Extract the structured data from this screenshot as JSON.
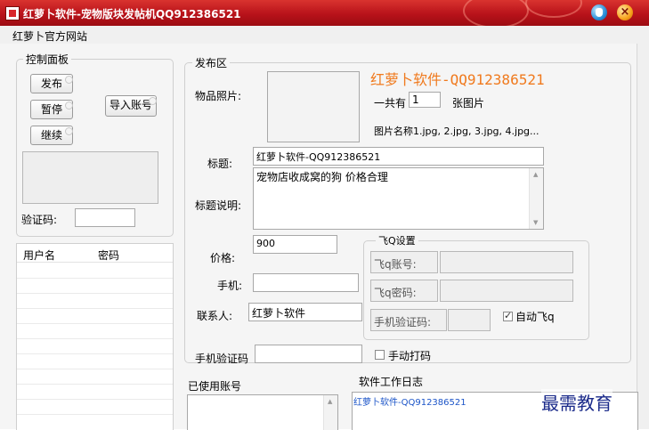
{
  "window": {
    "title": "红萝卜软件-宠物版块发帖机QQ912386521",
    "close_glyph": "×"
  },
  "menu": {
    "home": "红萝卜官方网站"
  },
  "control_panel": {
    "title": "控制面板",
    "publish": "发布",
    "pause": "暂停",
    "continue": "继续",
    "import": "导入账号",
    "captcha_label": "验证码:",
    "captcha_value": ""
  },
  "accounts_table": {
    "columns": [
      "用户名",
      "密码"
    ]
  },
  "publish_area": {
    "title": "发布区",
    "brand": "红萝卜软件-QQ912386521",
    "photo_label": "物品照片:",
    "count_prefix": "一共有",
    "count_value": "1",
    "count_suffix": "张图片",
    "names_label": "图片名称1.jpg, 2.jpg, 3.jpg, 4.jpg...",
    "title_label": "标题:",
    "title_value": "红萝卜软件-QQ912386521",
    "desc_label": "标题说明:",
    "desc_value": "宠物店收成窝的狗 价格合理",
    "price_label": "价格:",
    "price_value": "900",
    "phone_label": "手机:",
    "phone_value": "",
    "contact_label": "联系人:",
    "contact_value": "红萝卜软件",
    "sms_label": "手机验证码",
    "sms_value": ""
  },
  "feiq": {
    "title": "飞Q设置",
    "account_label": "飞q账号:",
    "password_label": "飞q密码:",
    "sms_label": "手机验证码:",
    "auto_label": "自动飞q",
    "auto_checked": true
  },
  "manual_code": {
    "label": "手动打码",
    "checked": false
  },
  "used_accounts": {
    "title": "已使用账号"
  },
  "log": {
    "title": "软件工作日志",
    "lines": [
      "红萝卜软件-QQ912386521"
    ]
  },
  "watermark": "最需教育",
  "colors": {
    "titlebar": "#b8121a",
    "brand": "#f07a1e",
    "log_text": "#1c55c8"
  }
}
